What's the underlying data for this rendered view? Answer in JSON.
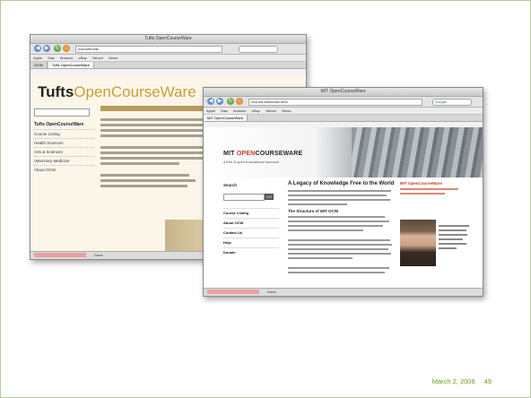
{
  "slide": {
    "date": "March 2, 2006",
    "page_number": "49",
    "accent_color": "#6e9a22"
  },
  "back_window": {
    "title": "Tufts OpenCourseWare",
    "url": "ocw.tufts.edu",
    "bookmarks": [
      "Apple",
      "Mac",
      "Amazon",
      "eBay",
      "Yahoo!",
      "News"
    ],
    "tabs": [
      "OCW",
      "Tufts OpenCourseWare"
    ],
    "logo_part1": "Tufts",
    "logo_part2": "OpenCourseWare",
    "sidebar_heading": "Tufts OpenCourseWare",
    "sidebar_items": [
      "Course Listing",
      "Health Sciences",
      "Arts & Sciences",
      "Veterinary Medicine",
      "About OCW"
    ],
    "status_items": [
      "Done"
    ]
  },
  "front_window": {
    "title": "MIT OpenCourseWare",
    "url": "ocw.mit.edu/index.html",
    "search_placeholder": "Google",
    "bookmarks": [
      "Apple",
      "Mac",
      "Amazon",
      "eBay",
      "Yahoo!",
      "News"
    ],
    "tabs": [
      "MIT OpenCourseWare"
    ],
    "logo_part1": "MIT",
    "logo_part2": "OPEN",
    "logo_part3": "COURSEWARE",
    "tagline": "a free & open educational resource",
    "search_label": "Search",
    "go_label": "GO",
    "nav_items": [
      "Course Listing",
      "About OCW",
      "Contact Us",
      "Help",
      "Donate"
    ],
    "headline": "A Legacy of Knowledge Free to the World",
    "subhead": "The Structure of MIT OCW",
    "announcement": "MIT OpenCourseWare",
    "status_items": [
      "Done"
    ]
  }
}
